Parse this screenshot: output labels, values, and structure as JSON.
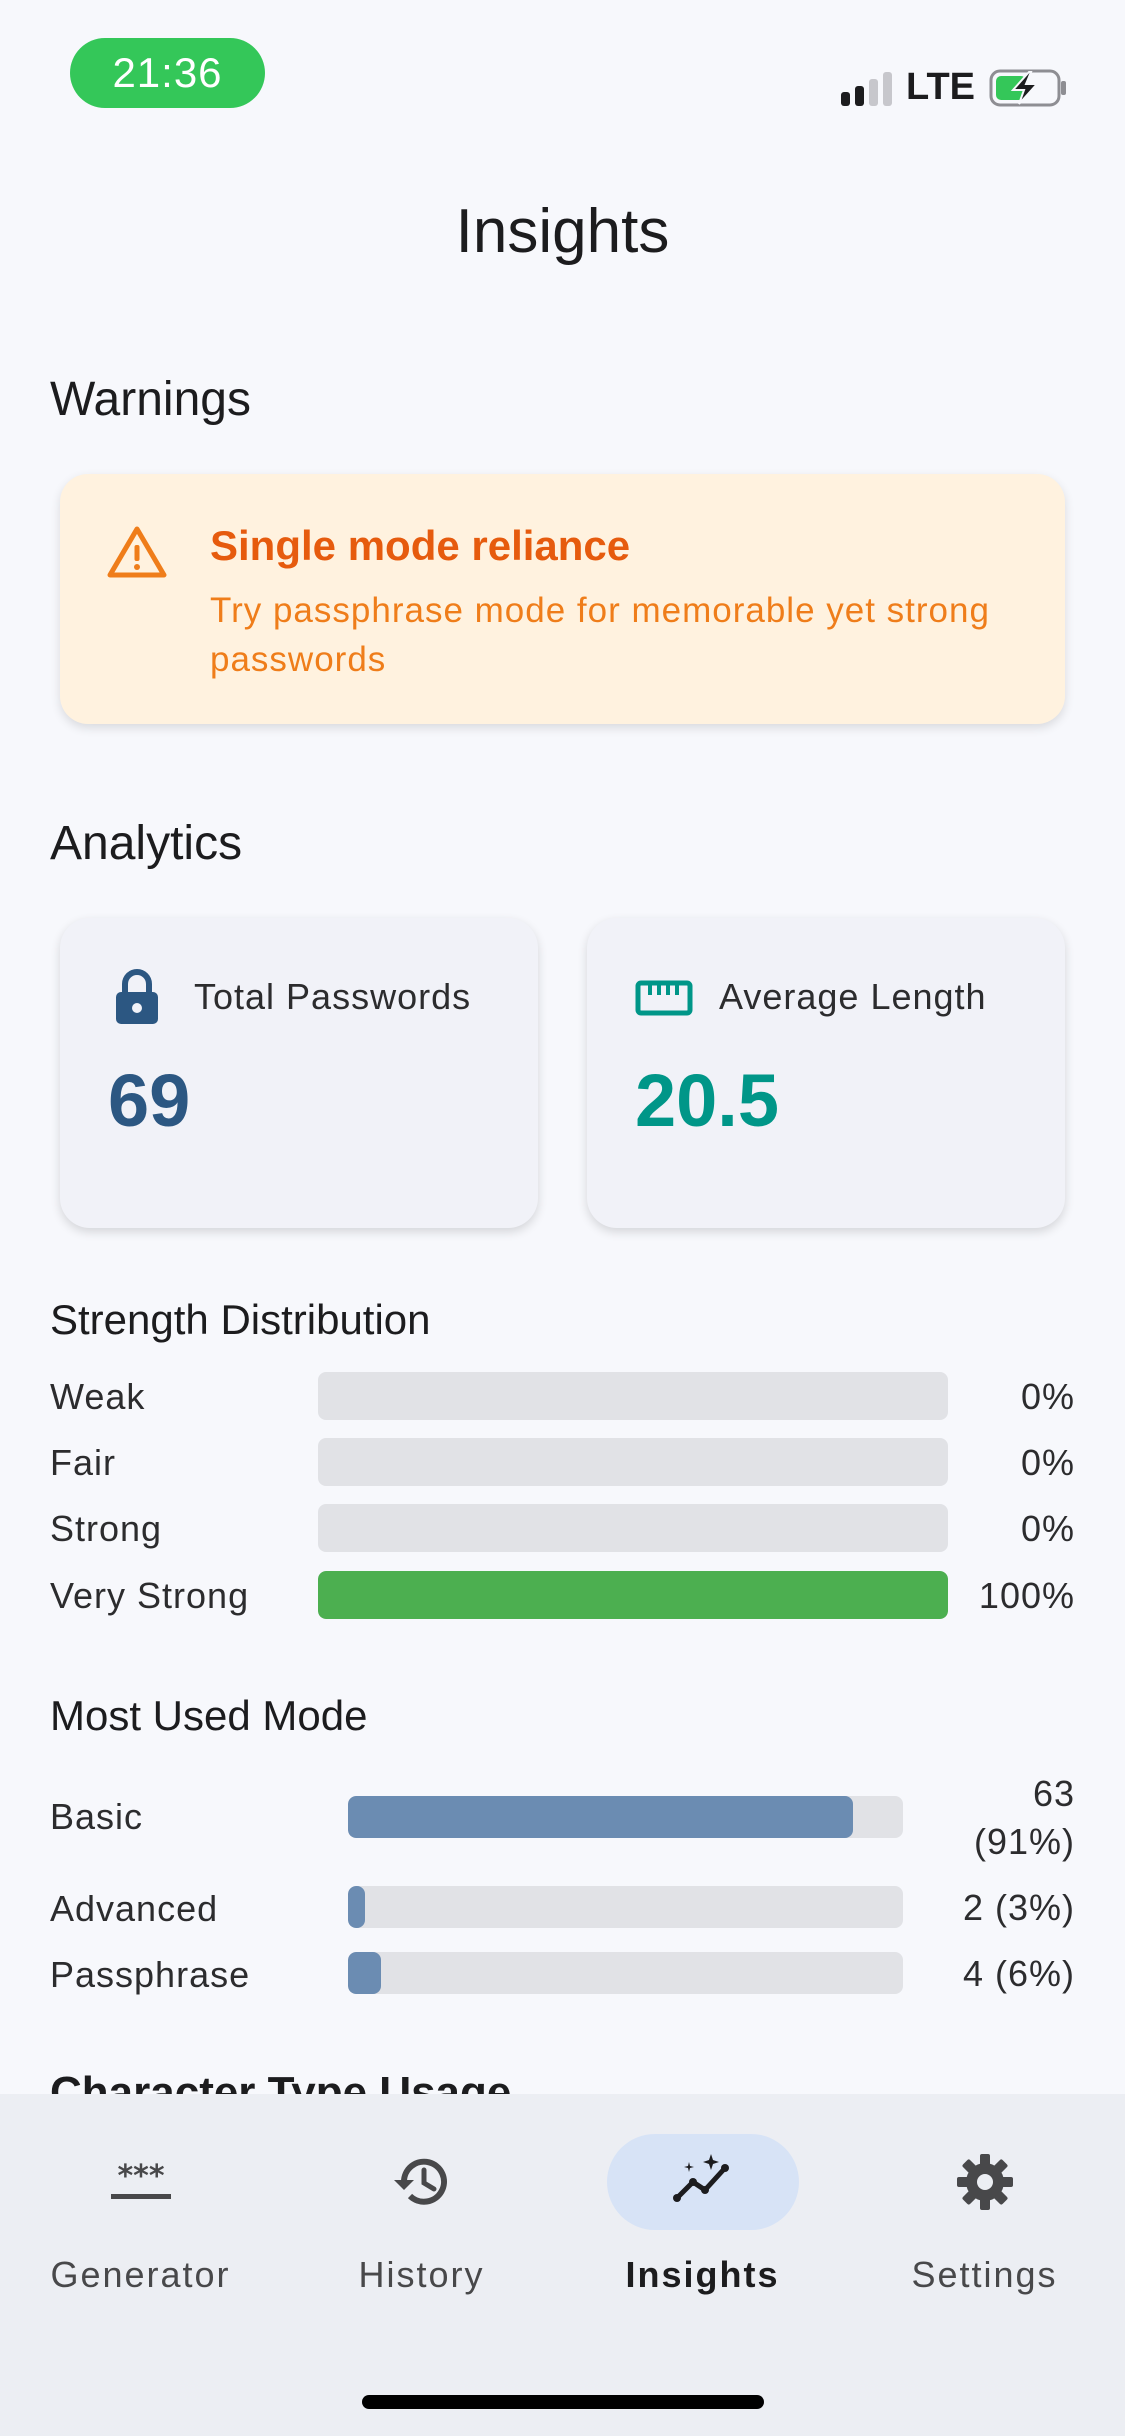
{
  "status_bar": {
    "time": "21:36",
    "network": "LTE",
    "time_pill_color": "#34c759",
    "battery_state": "charging"
  },
  "page_title": "Insights",
  "warnings": {
    "heading": "Warnings",
    "items": [
      {
        "icon": "warning-triangle-icon",
        "title": "Single mode reliance",
        "description": "Try passphrase mode for memorable yet strong passwords",
        "color": "#e65b0e"
      }
    ]
  },
  "analytics": {
    "heading": "Analytics",
    "cards": [
      {
        "icon": "lock-icon",
        "label": "Total Passwords",
        "value": "69",
        "color": "#2c5782"
      },
      {
        "icon": "ruler-icon",
        "label": "Average Length",
        "value": "20.5",
        "color": "#009688"
      }
    ]
  },
  "strength_distribution": {
    "heading": "Strength Distribution",
    "bar_color": "#4caf50",
    "rows": [
      {
        "label": "Weak",
        "percent_text": "0%",
        "fraction": 0
      },
      {
        "label": "Fair",
        "percent_text": "0%",
        "fraction": 0
      },
      {
        "label": "Strong",
        "percent_text": "0%",
        "fraction": 0
      },
      {
        "label": "Very Strong",
        "percent_text": "100%",
        "fraction": 1
      }
    ]
  },
  "most_used_mode": {
    "heading": "Most Used Mode",
    "bar_color": "#6b8cb2",
    "rows": [
      {
        "label": "Basic",
        "count_line1": "63",
        "count_line2": "(91%)",
        "fraction": 0.91
      },
      {
        "label": "Advanced",
        "count_line1": "2 (3%)",
        "count_line2": "",
        "fraction": 0.03
      },
      {
        "label": "Passphrase",
        "count_line1": "4 (6%)",
        "count_line2": "",
        "fraction": 0.06
      }
    ]
  },
  "next_section_heading": "Character Type Usage",
  "bottom_nav": {
    "items": [
      {
        "label": "Generator",
        "icon": "password-asterisks-icon",
        "active": false
      },
      {
        "label": "History",
        "icon": "history-clock-icon",
        "active": false
      },
      {
        "label": "Insights",
        "icon": "insights-chart-icon",
        "active": true
      },
      {
        "label": "Settings",
        "icon": "gear-icon",
        "active": false
      }
    ]
  }
}
